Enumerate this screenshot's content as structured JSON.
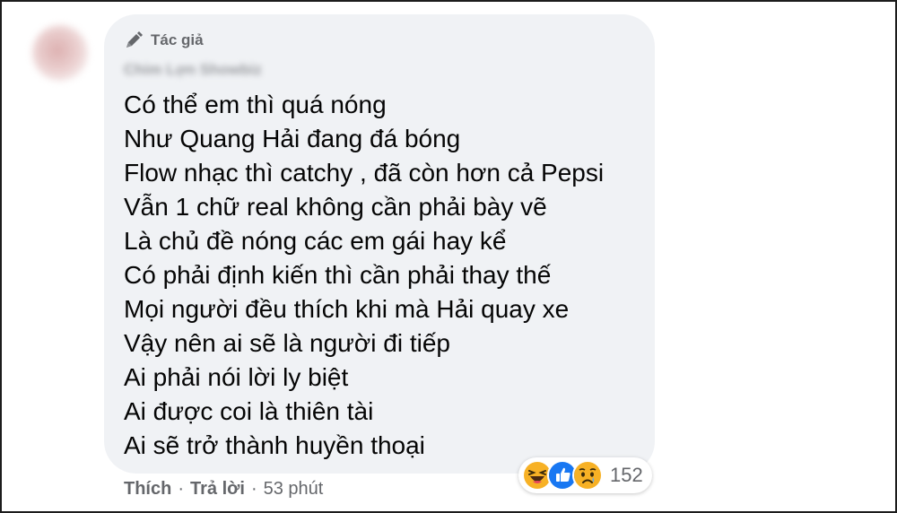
{
  "comment": {
    "author_badge": "Tác giả",
    "author_name": "Chim Lợn Showbiz",
    "lines": [
      "Có thể em thì quá nóng",
      "Như Quang Hải đang đá bóng",
      "Flow nhạc thì catchy , đã còn hơn cả Pepsi",
      "Vẫn 1 chữ real không cần phải bày vẽ",
      "Là chủ đề nóng các em gái hay kể",
      "Có phải định kiến thì cần phải thay thế",
      "Mọi người đều thích khi mà Hải quay xe",
      "Vậy nên ai sẽ là người đi tiếp",
      "Ai phải nói lời ly biệt",
      "Ai được coi là thiên tài",
      "Ai sẽ trở thành huyền thoại"
    ]
  },
  "actions": {
    "like": "Thích",
    "reply": "Trả lời",
    "separator": "·",
    "time": "53 phút"
  },
  "reactions": {
    "icons": [
      "haha-icon",
      "like-icon",
      "sad-icon"
    ],
    "count": "152",
    "colors": {
      "haha": "#f7b125",
      "like": "#1877f2",
      "sad": "#f7b125"
    }
  }
}
